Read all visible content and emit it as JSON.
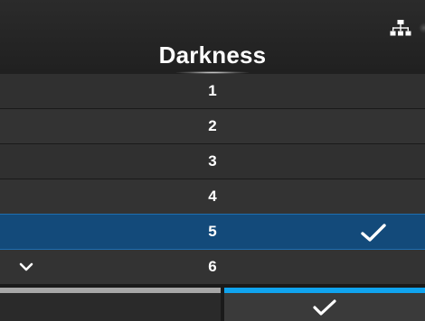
{
  "header": {
    "title": "Darkness",
    "status_icon": "network-icon"
  },
  "list": {
    "items": [
      {
        "label": "1",
        "selected": false
      },
      {
        "label": "2",
        "selected": false
      },
      {
        "label": "3",
        "selected": false
      },
      {
        "label": "4",
        "selected": false
      },
      {
        "label": "5",
        "selected": true
      },
      {
        "label": "6",
        "selected": false
      }
    ],
    "more_below_icon": "chevron-down-icon",
    "selected_icon": "checkmark-icon"
  },
  "footer": {
    "back_button_icon": "none",
    "confirm_button_icon": "checkmark-icon"
  },
  "colors": {
    "background": "#1a1a1a",
    "row": "#333333",
    "selected_row": "#134a7a",
    "confirm_accent": "#10a4ef",
    "back_accent": "#a7a7a7"
  }
}
